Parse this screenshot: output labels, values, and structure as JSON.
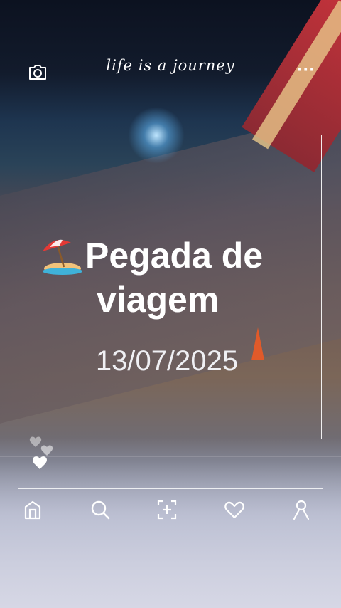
{
  "header": {
    "tagline": "life is a journey",
    "camera_icon": "camera-icon",
    "more_icon": "more-dots-icon",
    "more_label": "···"
  },
  "card": {
    "emoji_icon": "beach-umbrella-icon",
    "title_line1": "Pegada de",
    "title_line2": "viagem",
    "date": "13/07/2025"
  },
  "reactions": {
    "icon": "hearts-icon"
  },
  "bottom_nav": {
    "items": [
      {
        "name": "home-icon"
      },
      {
        "name": "search-icon"
      },
      {
        "name": "scan-add-icon"
      },
      {
        "name": "heart-icon"
      },
      {
        "name": "profile-icon"
      }
    ]
  },
  "colors": {
    "text": "#ffffff",
    "tail_red": "#c8333b",
    "cone_orange": "#e05a2a"
  }
}
